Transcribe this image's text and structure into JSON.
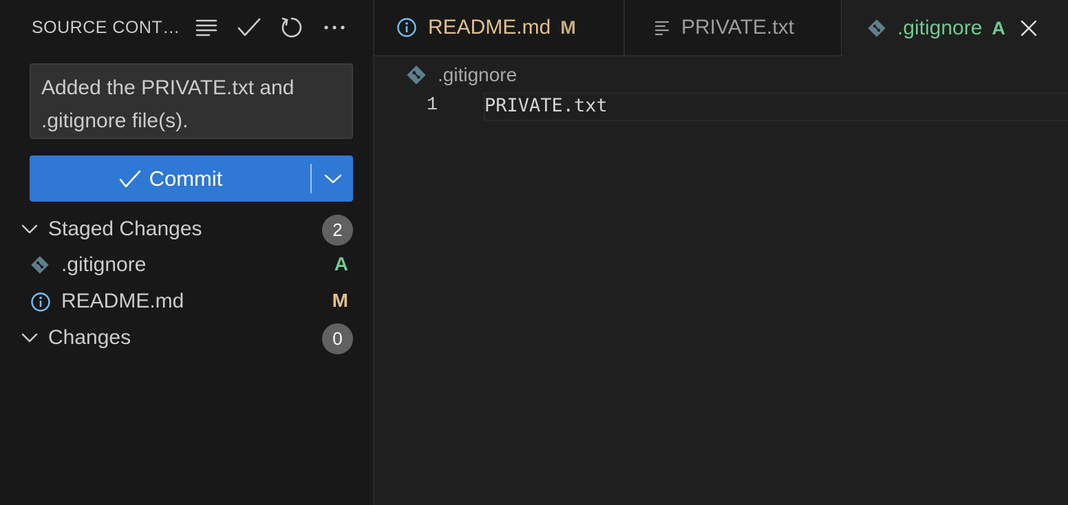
{
  "sidebar": {
    "title": "SOURCE CONT…",
    "actions": [
      "view-as-tree",
      "commit-check",
      "refresh",
      "more-actions"
    ],
    "commit_message": "Added the PRIVATE.txt and .gitignore file(s).",
    "commit_button_label": "Commit",
    "staged": {
      "label": "Staged Changes",
      "count": "2",
      "files": [
        {
          "name": ".gitignore",
          "status": "A",
          "icon": "git-diamond-icon",
          "status_color": "#73c991"
        },
        {
          "name": "README.md",
          "status": "M",
          "icon": "info-icon",
          "status_color": "#e2c08d"
        }
      ]
    },
    "changes": {
      "label": "Changes",
      "count": "0"
    }
  },
  "tabs": [
    {
      "name": "README.md",
      "status": "M",
      "icon": "info-icon",
      "color": "#e2c08d"
    },
    {
      "name": "PRIVATE.txt",
      "status": "",
      "icon": "text-lines-icon",
      "color": "#9d9d9d"
    },
    {
      "name": ".gitignore",
      "status": "A",
      "icon": "git-diamond-icon",
      "color": "#73c991",
      "active": true
    }
  ],
  "editor": {
    "breadcrumb": ".gitignore",
    "lines": [
      {
        "number": "1",
        "text": "PRIVATE.txt"
      }
    ]
  },
  "colors": {
    "accent": "#2f78d3",
    "added": "#73c991",
    "modified": "#e2c08d",
    "info_icon": "#75beff"
  }
}
